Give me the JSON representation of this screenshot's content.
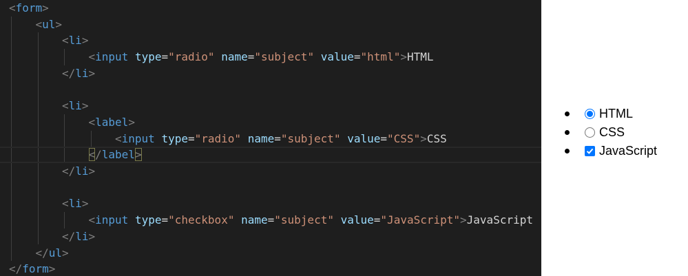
{
  "editor": {
    "lines": [
      [
        [
          "bracket",
          "<"
        ],
        [
          "tag",
          "form"
        ],
        [
          "bracket",
          ">"
        ]
      ],
      [
        [
          "bracket",
          "<"
        ],
        [
          "tag",
          "ul"
        ],
        [
          "bracket",
          ">"
        ]
      ],
      [
        [
          "bracket",
          "<"
        ],
        [
          "tag",
          "li"
        ],
        [
          "bracket",
          ">"
        ]
      ],
      [
        [
          "bracket",
          "<"
        ],
        [
          "tag",
          "input"
        ],
        [
          "text",
          " "
        ],
        [
          "attr",
          "type"
        ],
        [
          "eq",
          "="
        ],
        [
          "str",
          "\"radio\""
        ],
        [
          "text",
          " "
        ],
        [
          "attr",
          "name"
        ],
        [
          "eq",
          "="
        ],
        [
          "str",
          "\"subject\""
        ],
        [
          "text",
          " "
        ],
        [
          "attr",
          "value"
        ],
        [
          "eq",
          "="
        ],
        [
          "str",
          "\"html\""
        ],
        [
          "bracket",
          ">"
        ],
        [
          "text",
          "HTML"
        ]
      ],
      [
        [
          "bracket",
          "</"
        ],
        [
          "tag",
          "li"
        ],
        [
          "bracket",
          ">"
        ]
      ],
      [],
      [
        [
          "bracket",
          "<"
        ],
        [
          "tag",
          "li"
        ],
        [
          "bracket",
          ">"
        ]
      ],
      [
        [
          "bracket",
          "<"
        ],
        [
          "tag",
          "label"
        ],
        [
          "bracket",
          ">"
        ]
      ],
      [
        [
          "bracket",
          "<"
        ],
        [
          "tag",
          "input"
        ],
        [
          "text",
          " "
        ],
        [
          "attr",
          "type"
        ],
        [
          "eq",
          "="
        ],
        [
          "str",
          "\"radio\""
        ],
        [
          "text",
          " "
        ],
        [
          "attr",
          "name"
        ],
        [
          "eq",
          "="
        ],
        [
          "str",
          "\"subject\""
        ],
        [
          "text",
          " "
        ],
        [
          "attr",
          "value"
        ],
        [
          "eq",
          "="
        ],
        [
          "str",
          "\"CSS\""
        ],
        [
          "bracket",
          ">"
        ],
        [
          "text",
          "CSS"
        ]
      ],
      [
        [
          "bracket",
          "<"
        ],
        [
          "bracket",
          "/"
        ],
        [
          "tag",
          "label"
        ],
        [
          "bracket",
          ">"
        ]
      ],
      [
        [
          "bracket",
          "</"
        ],
        [
          "tag",
          "li"
        ],
        [
          "bracket",
          ">"
        ]
      ],
      [],
      [
        [
          "bracket",
          "<"
        ],
        [
          "tag",
          "li"
        ],
        [
          "bracket",
          ">"
        ]
      ],
      [
        [
          "bracket",
          "<"
        ],
        [
          "tag",
          "input"
        ],
        [
          "text",
          " "
        ],
        [
          "attr",
          "type"
        ],
        [
          "eq",
          "="
        ],
        [
          "str",
          "\"checkbox\""
        ],
        [
          "text",
          " "
        ],
        [
          "attr",
          "name"
        ],
        [
          "eq",
          "="
        ],
        [
          "str",
          "\"subject\""
        ],
        [
          "text",
          " "
        ],
        [
          "attr",
          "value"
        ],
        [
          "eq",
          "="
        ],
        [
          "str",
          "\"JavaScript\""
        ],
        [
          "bracket",
          ">"
        ],
        [
          "text",
          "JavaScript"
        ]
      ],
      [
        [
          "bracket",
          "</"
        ],
        [
          "tag",
          "li"
        ],
        [
          "bracket",
          ">"
        ]
      ],
      [
        [
          "bracket",
          "</"
        ],
        [
          "tag",
          "ul"
        ],
        [
          "bracket",
          ">"
        ]
      ],
      [
        [
          "bracket",
          "</"
        ],
        [
          "tag",
          "form"
        ],
        [
          "bracket",
          ">"
        ]
      ]
    ],
    "indents": [
      0,
      1,
      2,
      3,
      2,
      0,
      2,
      3,
      4,
      3,
      2,
      0,
      2,
      3,
      2,
      1,
      0
    ],
    "current_line": 9,
    "colors": {
      "background": "#1e1e1e",
      "bracket": "#808080",
      "tag": "#569cd6",
      "attr": "#9cdcfe",
      "string": "#ce9178",
      "text": "#d4d4d4"
    }
  },
  "preview": {
    "items": [
      {
        "control": "radio",
        "checked": true,
        "label": "HTML"
      },
      {
        "control": "radio",
        "checked": false,
        "label": "CSS"
      },
      {
        "control": "checkbox",
        "checked": true,
        "label": "JavaScript"
      }
    ],
    "accent": "#0075ff"
  }
}
